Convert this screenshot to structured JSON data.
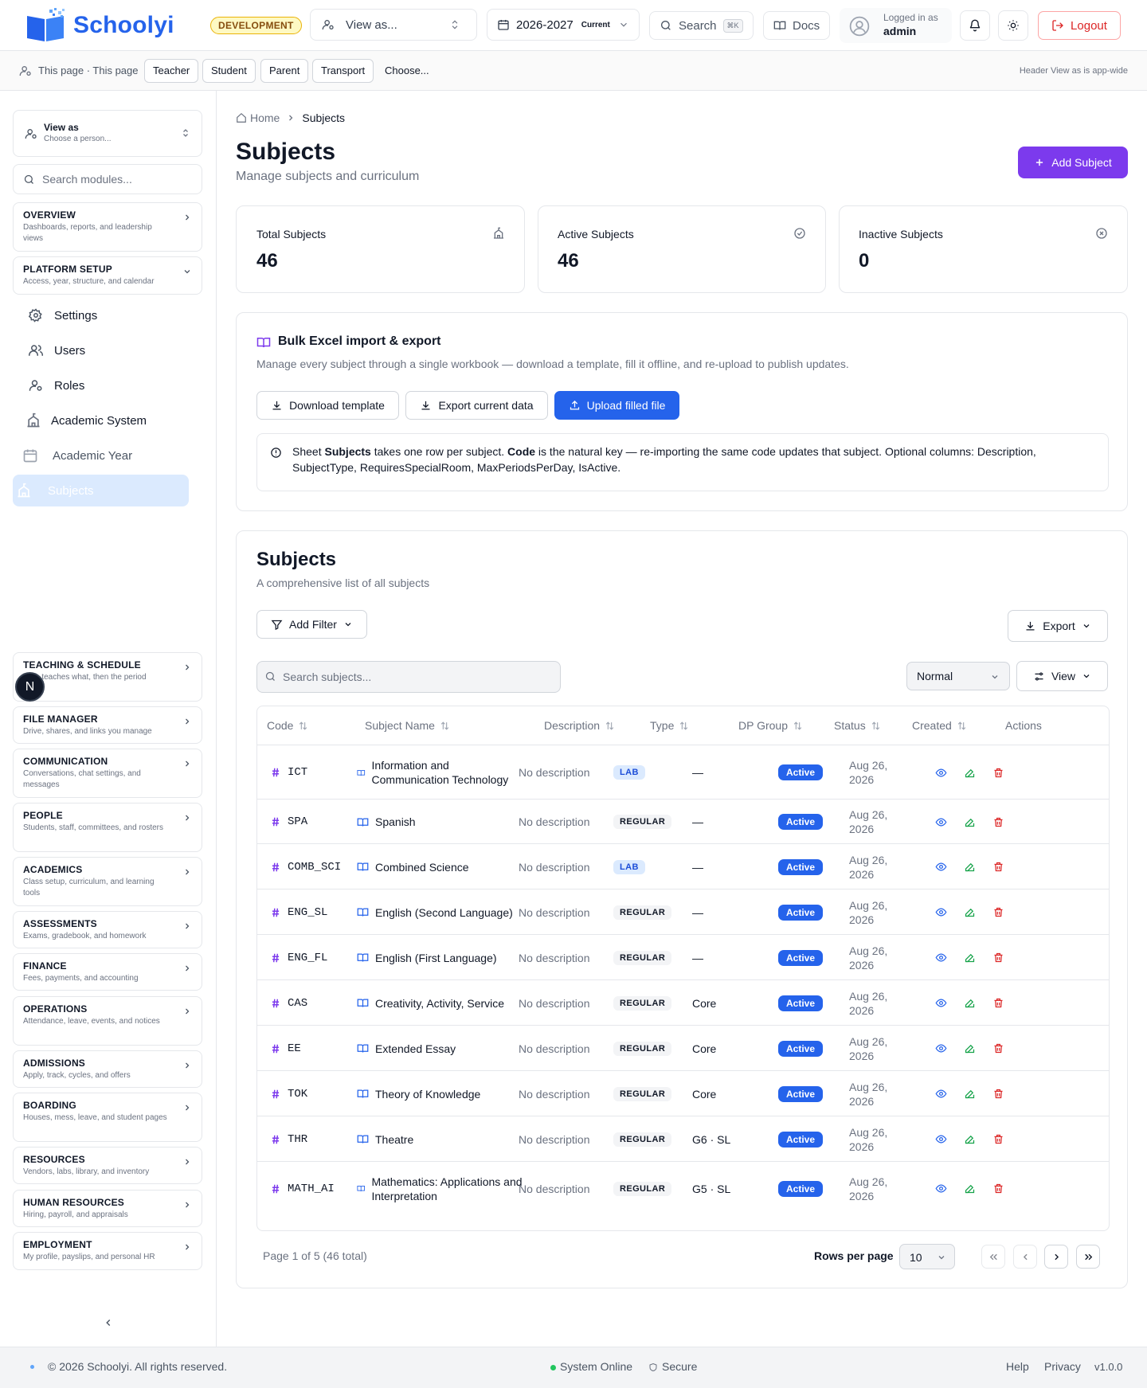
{
  "header": {
    "logo_text": "Schoolyi",
    "env_badge": "DEVELOPMENT",
    "view_as": "View as...",
    "year": "2026-2027",
    "year_tag": "Current",
    "search": "Search",
    "search_kbd": "⌘K",
    "docs": "Docs",
    "logged_in_label": "Logged in as",
    "user": "admin",
    "logout": "Logout"
  },
  "subbar": {
    "page_label": "This page · This page",
    "chips": [
      "Teacher",
      "Student",
      "Parent",
      "Transport"
    ],
    "choose": "Choose...",
    "note": "Header View as is app-wide"
  },
  "sidebar": {
    "view_as_title": "View as",
    "view_as_sub": "Choose a person...",
    "search_placeholder": "Search modules...",
    "overview": {
      "title": "OVERVIEW",
      "desc": "Dashboards, reports, and leadership views"
    },
    "platform": {
      "title": "PLATFORM SETUP",
      "desc": "Access, year, structure, and calendar"
    },
    "platform_items": [
      "Settings",
      "Users",
      "Roles",
      "Academic System",
      "Academic Year",
      "Subjects"
    ],
    "sections": [
      {
        "title": "TEACHING & SCHEDULE",
        "desc": "Who teaches what, then the period"
      },
      {
        "title": "FILE MANAGER",
        "desc": "Drive, shares, and links you manage"
      },
      {
        "title": "COMMUNICATION",
        "desc": "Conversations, chat settings, and messages"
      },
      {
        "title": "PEOPLE",
        "desc": "Students, staff, committees, and rosters"
      },
      {
        "title": "ACADEMICS",
        "desc": "Class setup, curriculum, and learning tools"
      },
      {
        "title": "ASSESSMENTS",
        "desc": "Exams, gradebook, and homework"
      },
      {
        "title": "FINANCE",
        "desc": "Fees, payments, and accounting"
      },
      {
        "title": "OPERATIONS",
        "desc": "Attendance, leave, events, and notices"
      },
      {
        "title": "ADMISSIONS",
        "desc": "Apply, track, cycles, and offers"
      },
      {
        "title": "BOARDING",
        "desc": "Houses, mess, leave, and student pages"
      },
      {
        "title": "RESOURCES",
        "desc": "Vendors, labs, library, and inventory"
      },
      {
        "title": "HUMAN RESOURCES",
        "desc": "Hiring, payroll, and appraisals"
      },
      {
        "title": "EMPLOYMENT",
        "desc": "My profile, payslips, and personal HR"
      }
    ],
    "avatar_letter": "N"
  },
  "breadcrumb": {
    "home": "Home",
    "current": "Subjects"
  },
  "page": {
    "title": "Subjects",
    "subtitle": "Manage subjects and curriculum",
    "add_button": "Add Subject"
  },
  "stats": [
    {
      "label": "Total Subjects",
      "value": "46"
    },
    {
      "label": "Active Subjects",
      "value": "46"
    },
    {
      "label": "Inactive Subjects",
      "value": "0"
    }
  ],
  "bulk": {
    "title": "Bulk Excel import & export",
    "desc": "Manage every subject through a single workbook — download a template, fill it offline, and re-upload to publish updates.",
    "download": "Download template",
    "export": "Export current data",
    "upload": "Upload filled file",
    "note_1": "Sheet ",
    "note_sheet": "Subjects",
    "note_2": " takes one row per subject. ",
    "note_code": "Code",
    "note_3": " is the natural key — re-importing the same code updates that subject. Optional columns: Description, SubjectType, RequiresSpecialRoom, MaxPeriodsPerDay, IsActive."
  },
  "table_card": {
    "title": "Subjects",
    "subtitle": "A comprehensive list of all subjects",
    "add_filter": "Add Filter",
    "export": "Export",
    "search_placeholder": "Search subjects...",
    "density": "Normal",
    "view": "View",
    "columns": [
      "Code",
      "Subject Name",
      "Description",
      "Type",
      "DP Group",
      "Status",
      "Created",
      "Actions"
    ],
    "rows": [
      {
        "code": "ICT",
        "name": "Information and Communication Technology",
        "desc": "No description",
        "type": "LAB",
        "group": "—",
        "status": "Active",
        "created": "Aug 26, 2026"
      },
      {
        "code": "SPA",
        "name": "Spanish",
        "desc": "No description",
        "type": "REGULAR",
        "group": "—",
        "status": "Active",
        "created": "Aug 26, 2026"
      },
      {
        "code": "COMB_SCI",
        "name": "Combined Science",
        "desc": "No description",
        "type": "LAB",
        "group": "—",
        "status": "Active",
        "created": "Aug 26, 2026"
      },
      {
        "code": "ENG_SL",
        "name": "English (Second Language)",
        "desc": "No description",
        "type": "REGULAR",
        "group": "—",
        "status": "Active",
        "created": "Aug 26, 2026"
      },
      {
        "code": "ENG_FL",
        "name": "English (First Language)",
        "desc": "No description",
        "type": "REGULAR",
        "group": "—",
        "status": "Active",
        "created": "Aug 26, 2026"
      },
      {
        "code": "CAS",
        "name": "Creativity, Activity, Service",
        "desc": "No description",
        "type": "REGULAR",
        "group": "Core",
        "status": "Active",
        "created": "Aug 26, 2026"
      },
      {
        "code": "EE",
        "name": "Extended Essay",
        "desc": "No description",
        "type": "REGULAR",
        "group": "Core",
        "status": "Active",
        "created": "Aug 26, 2026"
      },
      {
        "code": "TOK",
        "name": "Theory of Knowledge",
        "desc": "No description",
        "type": "REGULAR",
        "group": "Core",
        "status": "Active",
        "created": "Aug 26, 2026"
      },
      {
        "code": "THR",
        "name": "Theatre",
        "desc": "No description",
        "type": "REGULAR",
        "group": "G6 · SL",
        "status": "Active",
        "created": "Aug 26, 2026"
      },
      {
        "code": "MATH_AI",
        "name": "Mathematics: Applications and Interpretation",
        "desc": "No description",
        "type": "REGULAR",
        "group": "G5 · SL",
        "status": "Active",
        "created": "Aug 26, 2026"
      }
    ],
    "page_info": "Page 1 of 5 (46 total)",
    "rows_per_page_label": "Rows per page",
    "rows_per_page": "10"
  },
  "footer": {
    "copyright": "© 2026 Schoolyi. All rights reserved.",
    "status": "System Online",
    "secure": "Secure",
    "help": "Help",
    "privacy": "Privacy",
    "version": "v1.0.0"
  },
  "colors": {
    "brand": "#2563eb",
    "accent": "#7c3aed",
    "active": "#2563eb"
  }
}
